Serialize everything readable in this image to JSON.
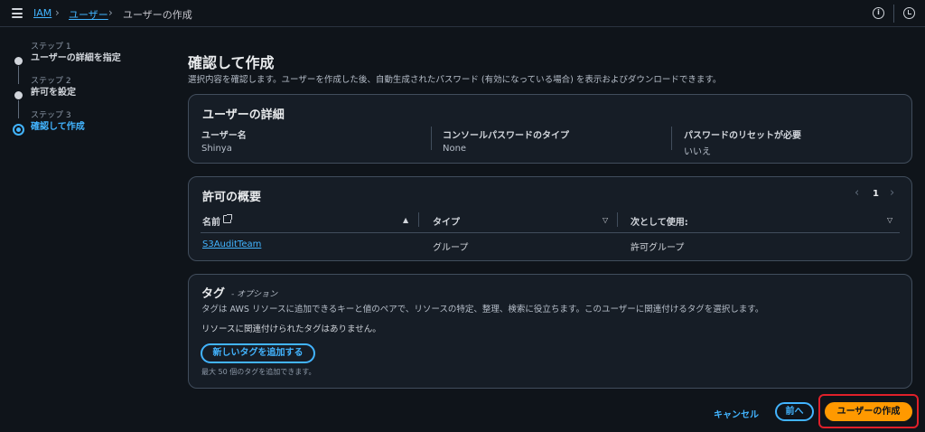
{
  "breadcrumb": {
    "items": [
      "IAM",
      "ユーザー",
      "ユーザーの作成"
    ]
  },
  "icons": {
    "menu": "hamburger-icon",
    "info": "info-icon",
    "history": "history-icon",
    "external_link": "external-link-icon"
  },
  "steps": [
    {
      "num": "ステップ 1",
      "title": "ユーザーの詳細を指定",
      "active": false
    },
    {
      "num": "ステップ 2",
      "title": "許可を設定",
      "active": false
    },
    {
      "num": "ステップ 3",
      "title": "確認して作成",
      "active": true
    }
  ],
  "page": {
    "title": "確認して作成",
    "description": "選択内容を確認します。ユーザーを作成した後、自動生成されたパスワード (有効になっている場合) を表示およびダウンロードできます。"
  },
  "user_details": {
    "title": "ユーザーの詳細",
    "fields": [
      {
        "label": "ユーザー名",
        "value": "Shinya"
      },
      {
        "label": "コンソールパスワードのタイプ",
        "value": "None"
      },
      {
        "label": "パスワードのリセットが必要",
        "value": "いいえ"
      }
    ]
  },
  "permissions": {
    "title": "許可の概要",
    "page": "1",
    "columns": [
      "名前",
      "タイプ",
      "次として使用:"
    ],
    "rows": [
      {
        "name": "S3AuditTeam",
        "type": "グループ",
        "used_as": "許可グループ"
      }
    ]
  },
  "tags": {
    "title": "タグ",
    "optional": "- オプション",
    "description": "タグは AWS リソースに追加できるキーと値のペアで、リソースの特定、整理、検索に役立ちます。このユーザーに関連付けるタグを選択します。",
    "empty": "リソースに関連付けられたタグはありません。",
    "add_button": "新しいタグを追加する",
    "hint": "最大 50 個のタグを追加できます。"
  },
  "footer": {
    "cancel": "キャンセル",
    "previous": "前へ",
    "create": "ユーザーの作成"
  },
  "colors": {
    "background": "#0f141a",
    "panel": "#161d26",
    "link": "#42b4ff",
    "primary_button": "#ff9900",
    "highlight": "#e0202a"
  }
}
